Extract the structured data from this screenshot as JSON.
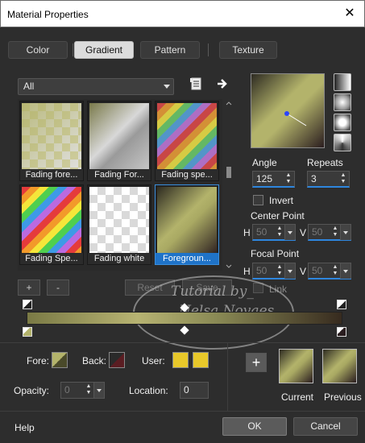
{
  "window": {
    "title": "Material Properties",
    "close_glyph": "✕"
  },
  "tabs": [
    {
      "label": "Color",
      "active": false
    },
    {
      "label": "Gradient",
      "active": true
    },
    {
      "label": "Pattern",
      "active": false
    },
    {
      "label": "Texture",
      "active": false
    }
  ],
  "filter": {
    "selected": "All"
  },
  "gallery": {
    "items": [
      {
        "label": "Fading fore...",
        "style": "fade-fore"
      },
      {
        "label": "Fading For...",
        "style": "fade-fore-gray"
      },
      {
        "label": "Fading spe...",
        "style": "spectrum-fade"
      },
      {
        "label": "Fading Spe...",
        "style": "spectrum"
      },
      {
        "label": "Fading white",
        "style": "white"
      },
      {
        "label": "Foregroun...",
        "style": "foreground",
        "selected": true
      }
    ]
  },
  "angle": {
    "label": "Angle",
    "value": "125"
  },
  "repeats": {
    "label": "Repeats",
    "value": "3"
  },
  "invert": {
    "label": "Invert",
    "checked": false
  },
  "center_point": {
    "label": "Center Point",
    "h_label": "H",
    "h_value": "50",
    "v_label": "V",
    "v_value": "50"
  },
  "focal_point": {
    "label": "Focal Point",
    "h_label": "H",
    "h_value": "50",
    "v_label": "V",
    "v_value": "50"
  },
  "link": {
    "label": "Link",
    "checked": false
  },
  "editor": {
    "add_label": "+",
    "remove_label": "-",
    "reset_label": "Reset",
    "save_label": "Save"
  },
  "watermark": {
    "line1": "Tutorial by_",
    "line2": "Nelsa Novaes"
  },
  "stops": {
    "fore_label": "Fore:",
    "back_label": "Back:",
    "user_label": "User:",
    "user_color": "#e8c82a",
    "opacity_label": "Opacity:",
    "opacity_value": "0",
    "location_label": "Location:",
    "location_value": "0"
  },
  "swatches": {
    "plus_label": "+",
    "current_label": "Current",
    "previous_label": "Previous"
  },
  "footer": {
    "help_label": "Help",
    "ok_label": "OK",
    "cancel_label": "Cancel"
  },
  "colors": {
    "accent": "#2e86de",
    "gradient_light": "#b3b36b",
    "gradient_dark": "#2a1d1f"
  }
}
